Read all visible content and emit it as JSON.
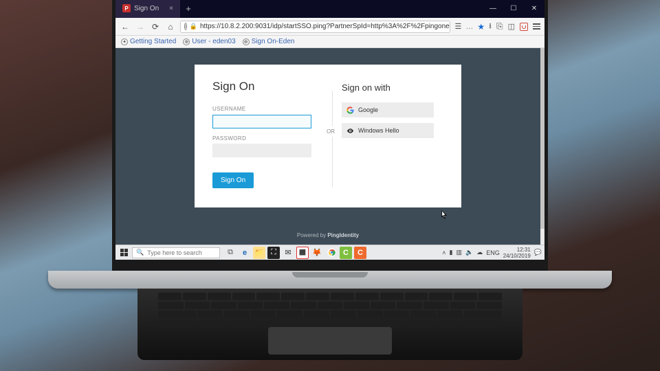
{
  "browser": {
    "tab_title": "Sign On",
    "tab_favicon_letter": "P",
    "url_info_glyph": "i",
    "url_text": "https://10.8.2.200:9031/idp/startSSO.ping?PartnerSpId=http%3A%2F%2Fpingone.com%2...",
    "bookmarks": [
      {
        "label": "Getting Started"
      },
      {
        "label": "User - eden03"
      },
      {
        "label": "Sign On-Eden"
      }
    ]
  },
  "page": {
    "heading": "Sign On",
    "username_label": "USERNAME",
    "password_label": "PASSWORD",
    "submit_label": "Sign On",
    "or_label": "OR",
    "sow_heading": "Sign on with",
    "idps": [
      {
        "name": "Google"
      },
      {
        "name": "Windows Hello"
      }
    ],
    "powered_prefix": "Powered by ",
    "powered_brand": "PingIdentity"
  },
  "taskbar": {
    "search_placeholder": "Type here to search",
    "tray_lang": "ENG",
    "clock_time": "12:31",
    "clock_date": "24/10/2019"
  }
}
